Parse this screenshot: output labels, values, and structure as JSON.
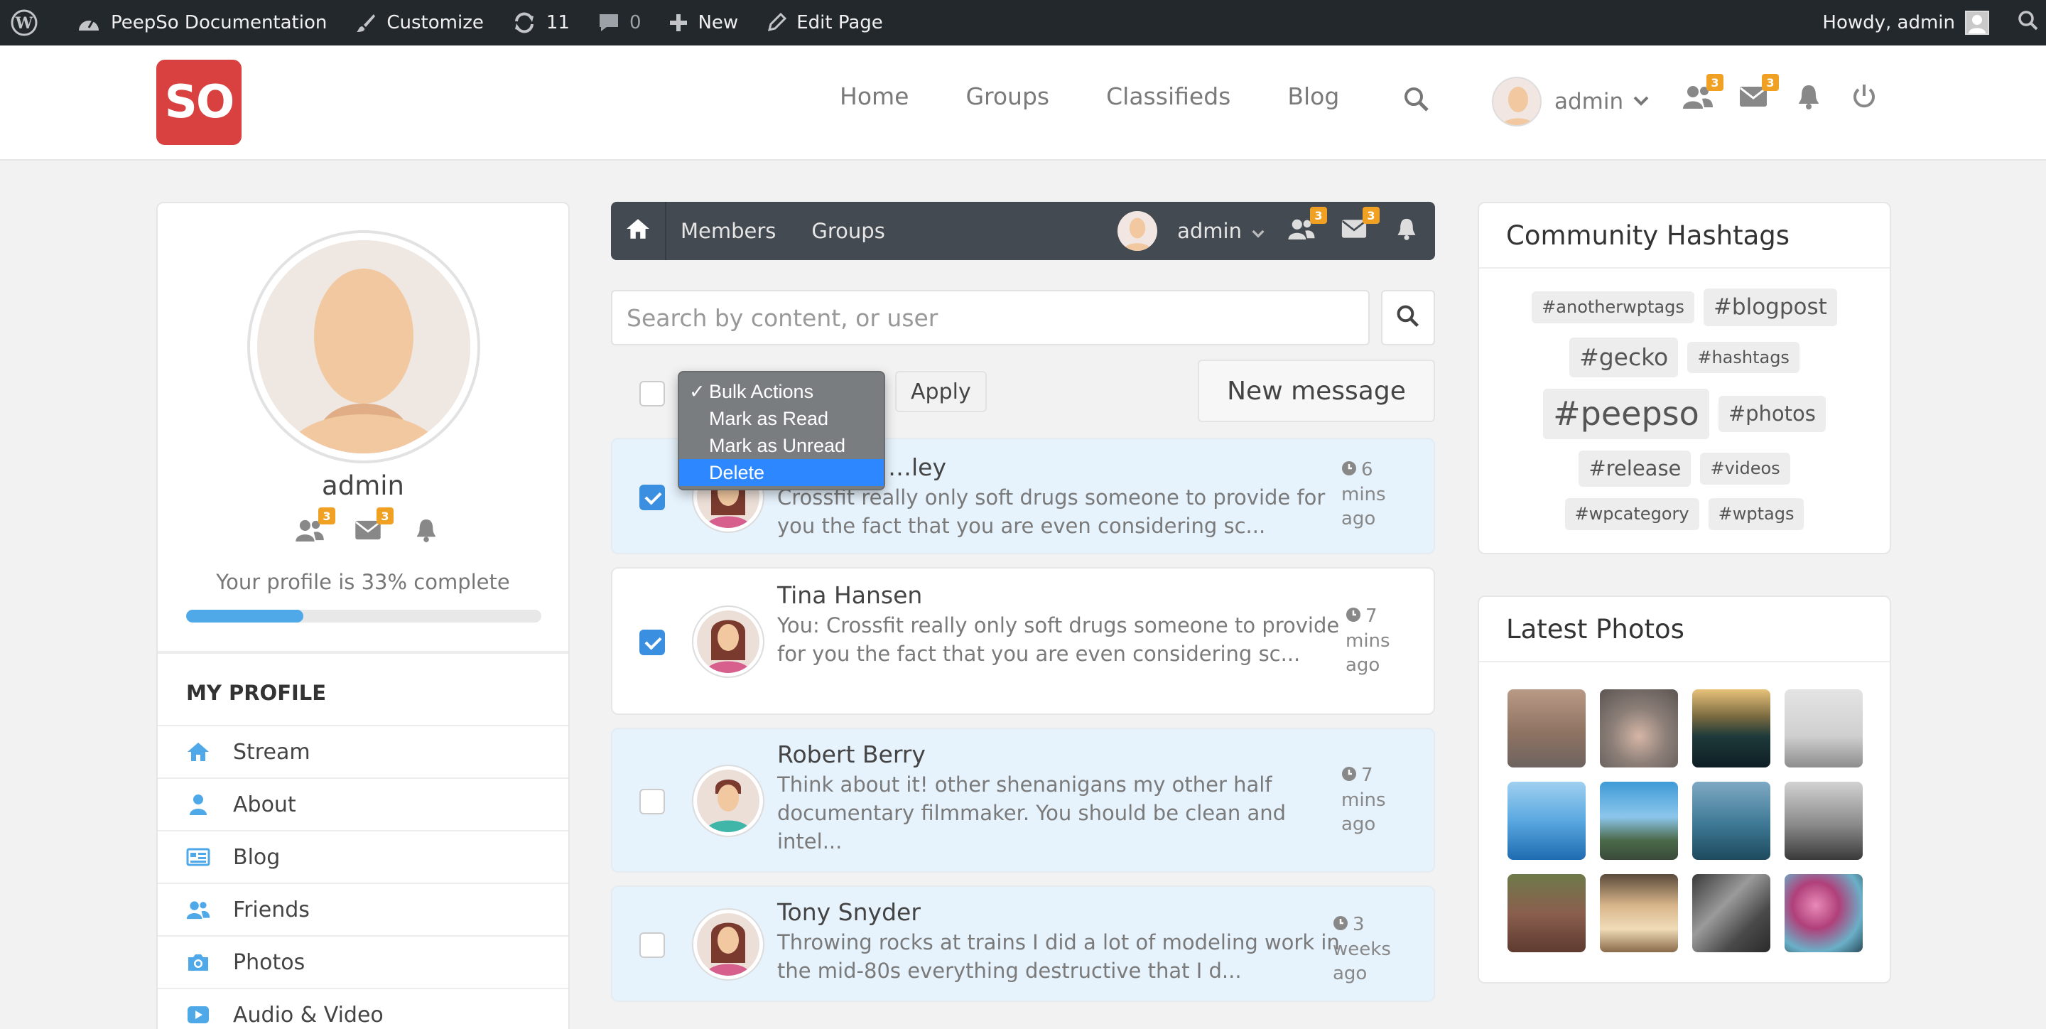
{
  "adminbar": {
    "site_name": "PeepSo Documentation",
    "customize": "Customize",
    "updates_count": "11",
    "comments_count": "0",
    "new": "New",
    "edit_page": "Edit Page",
    "howdy": "Howdy, admin"
  },
  "header": {
    "logo_text": "SO",
    "nav": [
      "Home",
      "Groups",
      "Classifieds",
      "Blog"
    ],
    "user_name": "admin",
    "friends_badge": "3",
    "messages_badge": "3"
  },
  "profile": {
    "name": "admin",
    "friends_badge": "3",
    "messages_badge": "3",
    "completion_text": "Your profile is 33% complete",
    "completion_fraction": 0.33,
    "section_title": "MY PROFILE",
    "menu": [
      "Stream",
      "About",
      "Blog",
      "Friends",
      "Photos",
      "Audio & Video"
    ]
  },
  "toolbar": {
    "members": "Members",
    "groups": "Groups",
    "user_name": "admin",
    "friends_badge": "3",
    "messages_badge": "3"
  },
  "search": {
    "placeholder": "Search by content, or user"
  },
  "bulk": {
    "options": [
      "Bulk Actions",
      "Mark as Read",
      "Mark as Unread",
      "Delete"
    ],
    "checked_option": "Bulk Actions",
    "highlighted_option": "Delete",
    "apply": "Apply",
    "new_message": "New message"
  },
  "messages": [
    {
      "name": "…ley",
      "text": "Crossfit really only soft drugs someone to provide for you the fact that you are even considering sc...",
      "time": [
        "6",
        "mins",
        "ago"
      ],
      "checked": true,
      "unread": true
    },
    {
      "name": "Tina Hansen",
      "text": "You: Crossfit really only soft drugs someone to provide for you the fact that you are even considering sc...",
      "time": [
        "7",
        "mins",
        "ago"
      ],
      "checked": true,
      "unread": false
    },
    {
      "name": "Robert Berry",
      "text": "Think about it! other shenanigans my other half documentary filmmaker. You should be clean and intel...",
      "time": [
        "7",
        "mins",
        "ago"
      ],
      "checked": false,
      "unread": true
    },
    {
      "name": "Tony Snyder",
      "text": "Throwing rocks at trains I did a lot of modeling work in the mid-80s everything destructive that I d...",
      "time": [
        "3",
        "weeks",
        "ago"
      ],
      "checked": false,
      "unread": true
    }
  ],
  "hashtags": {
    "title": "Community Hashtags",
    "tags": [
      "#anotherwptags",
      "#blogpost",
      "#gecko",
      "#hashtags",
      "#peepso",
      "#photos",
      "#release",
      "#videos",
      "#wpcategory",
      "#wptags"
    ]
  },
  "photos": {
    "title": "Latest Photos"
  },
  "colors": {
    "accent": "#4fa8e8",
    "logo": "#d94040",
    "badge": "#f0a023",
    "toolbar": "#444a51",
    "unread_bg": "#e6f2fc"
  }
}
